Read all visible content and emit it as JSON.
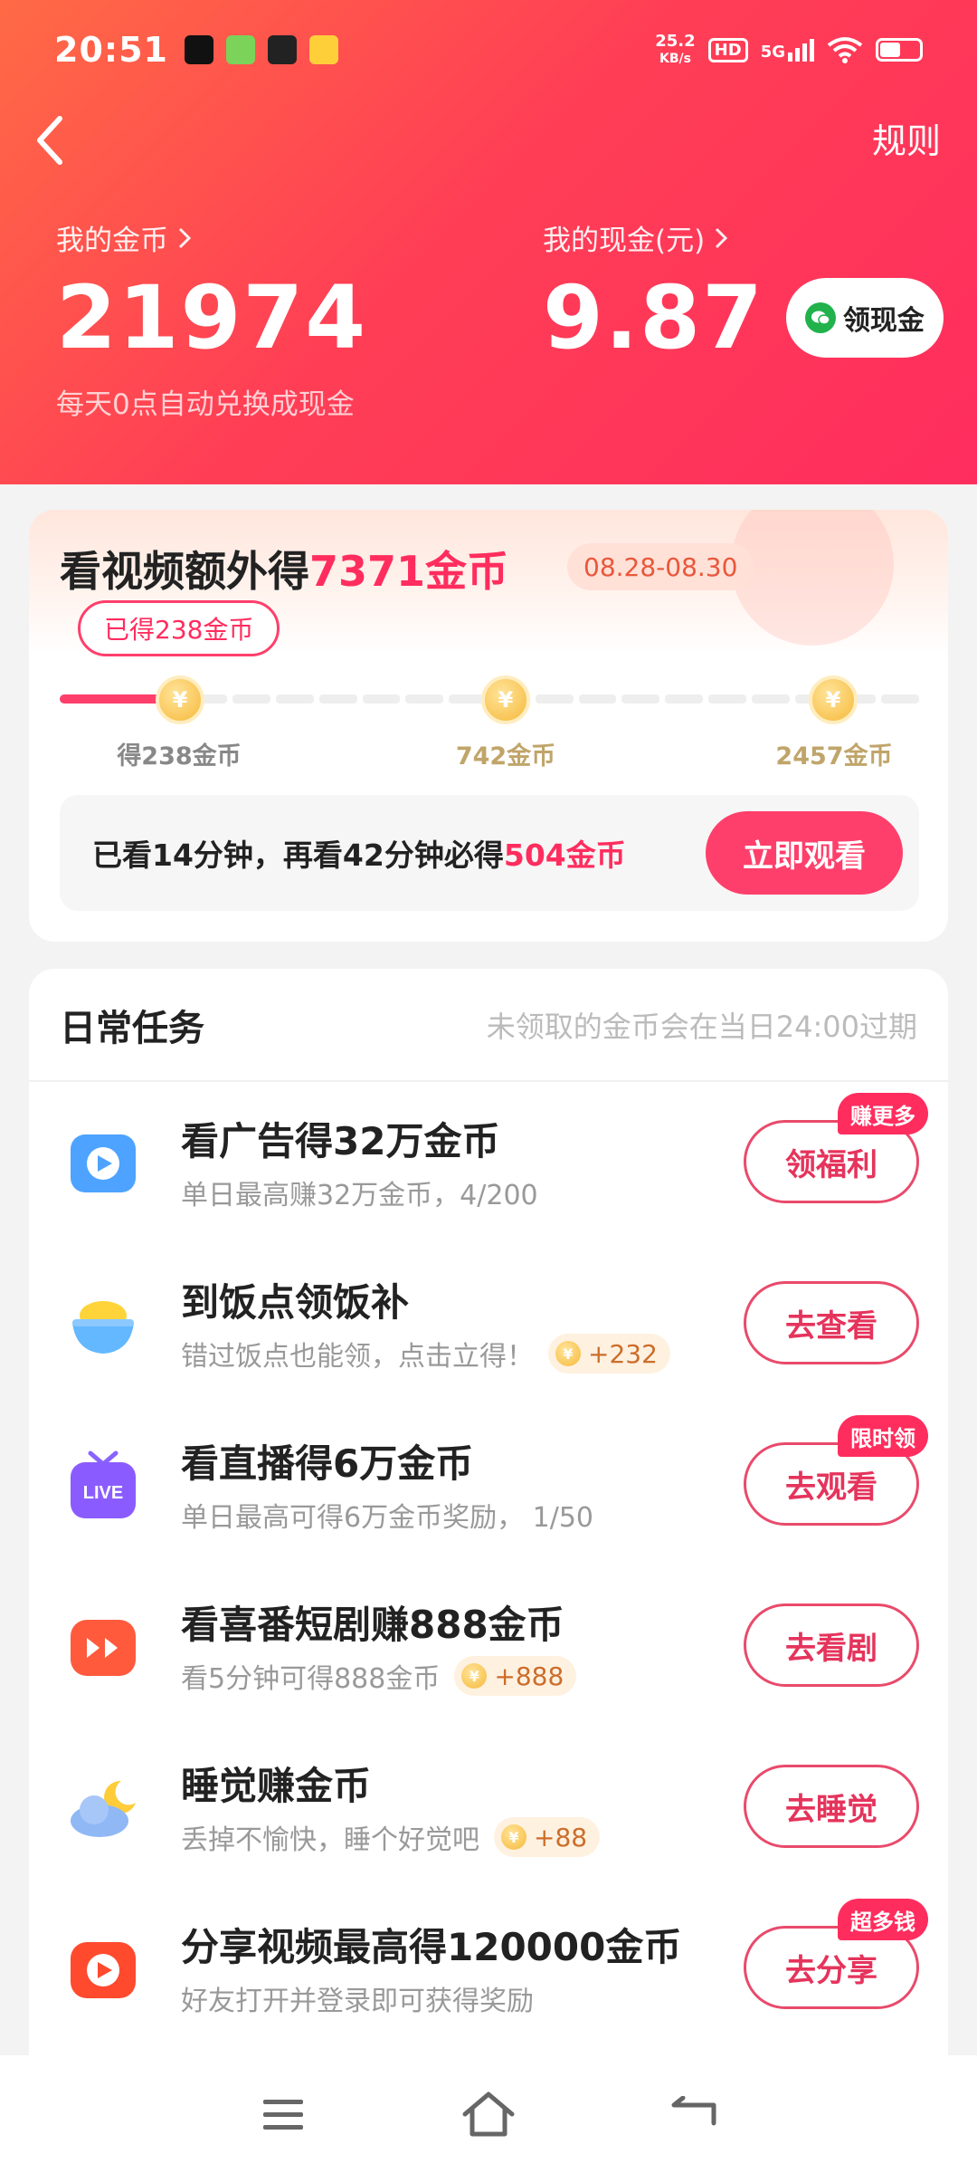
{
  "status_bar": {
    "time": "20:51",
    "net_speed_value": "25.2",
    "net_speed_unit": "KB/s",
    "hd_label": "HD",
    "network": "5G"
  },
  "header": {
    "rules": "规则",
    "coins_label": "我的金币",
    "coins_value": "21974",
    "coins_note": "每天0点自动兑换成现金",
    "cash_label": "我的现金(元)",
    "cash_value": "9.87",
    "withdraw_label": "领现金"
  },
  "bonus": {
    "title_prefix": "看视频额外得",
    "title_amount": "7371金币",
    "date_range": "08.28-08.30",
    "earned_chip": "已得238金币",
    "progress_fraction": 0.1,
    "milestones": [
      {
        "label": "得238金币"
      },
      {
        "label": "742金币"
      },
      {
        "label": "2457金币"
      }
    ],
    "coin_glyph": "¥",
    "watch_text_prefix": "已看14分钟，再看42分钟必得",
    "watch_text_amount": "504金币",
    "watch_button": "立即观看"
  },
  "tasks": {
    "title": "日常任务",
    "note": "未领取的金币会在当日24:00过期",
    "coin_glyph": "¥",
    "items": [
      {
        "icon": "video-ad-icon",
        "title": "看广告得32万金币",
        "desc": "单日最高赚32万金币，4/200",
        "reward": "",
        "button": "领福利",
        "badge": "赚更多"
      },
      {
        "icon": "rice-bowl-icon",
        "title": "到饭点领饭补",
        "desc": "错过饭点也能领，点击立得！",
        "reward": "+232",
        "button": "去查看",
        "badge": ""
      },
      {
        "icon": "live-tv-icon",
        "title": "看直播得6万金币",
        "desc": "单日最高可得6万金币奖励， 1/50",
        "reward": "",
        "button": "去观看",
        "badge": "限时领"
      },
      {
        "icon": "short-drama-icon",
        "title": "看喜番短剧赚888金币",
        "desc": "看5分钟可得888金币",
        "reward": "+888",
        "button": "去看剧",
        "badge": ""
      },
      {
        "icon": "moon-cloud-icon",
        "title": "睡觉赚金币",
        "desc": "丢掉不愉快，睡个好觉吧",
        "reward": "+88",
        "button": "去睡觉",
        "badge": ""
      },
      {
        "icon": "share-video-icon",
        "title": "分享视频最高得120000金币",
        "desc": "好友打开并登录即可获得奖励",
        "reward": "",
        "button": "去分享",
        "badge": "超多钱"
      }
    ]
  },
  "colors": {
    "accent": "#ff2d5e",
    "header_start": "#ff6a45",
    "coin_gold": "#f6b93b"
  }
}
